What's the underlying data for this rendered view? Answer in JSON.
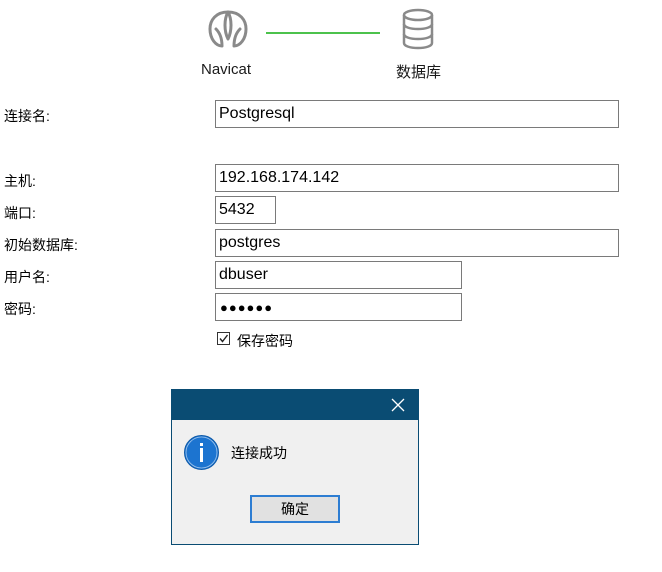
{
  "header": {
    "left_label": "Navicat",
    "right_label": "数据库",
    "connector_color": "#4cc24c",
    "left_icon": "navicat-logo-icon",
    "right_icon": "database-icon"
  },
  "form": {
    "connection_name": {
      "label": "连接名:",
      "value": "Postgresql"
    },
    "host": {
      "label": "主机:",
      "value": "192.168.174.142"
    },
    "port": {
      "label": "端口:",
      "value": "5432"
    },
    "initial_database": {
      "label": "初始数据库:",
      "value": "postgres"
    },
    "username": {
      "label": "用户名:",
      "value": "dbuser"
    },
    "password": {
      "label": "密码:",
      "masked_value": "●●●●●●"
    },
    "save_password": {
      "label": "保存密码",
      "checked": true
    }
  },
  "dialog": {
    "title_bar_color": "#0a4c73",
    "message": "连接成功",
    "ok_label": "确定",
    "icon": "info-icon",
    "close_icon": "close-icon"
  }
}
